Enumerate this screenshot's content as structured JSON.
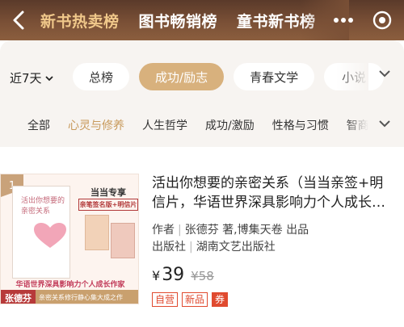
{
  "header": {
    "tabs": [
      {
        "label": "新书热卖榜",
        "active": true
      },
      {
        "label": "图书畅销榜",
        "active": false
      },
      {
        "label": "童书新书榜",
        "active": false
      }
    ],
    "icons": [
      "back-icon",
      "more-icon",
      "target-icon"
    ]
  },
  "filters": {
    "period": "近7天",
    "categories": [
      {
        "label": "总榜"
      },
      {
        "label": "成功/励志",
        "active": true
      },
      {
        "label": "青春文学"
      },
      {
        "label": "小说"
      }
    ],
    "subcategories": [
      {
        "label": "全部"
      },
      {
        "label": "心灵与修养",
        "active": true
      },
      {
        "label": "人生哲学"
      },
      {
        "label": "成功/激励"
      },
      {
        "label": "性格与习惯"
      },
      {
        "label": "智商"
      }
    ]
  },
  "product": {
    "rank": "1",
    "title": "活出你想要的亲密关系（当当亲签+明信片，华语世界深具影响力个人成长作家张德芬",
    "author_label": "作者",
    "author": "张德芬 著,博集天卷 出品",
    "publisher_label": "出版社",
    "publisher": "湖南文艺出版社",
    "currency": "¥",
    "price": "39",
    "original_price": "¥58",
    "tags": [
      "自营",
      "新品",
      "券"
    ],
    "cover": {
      "book_title": "活出你想要的亲密关系",
      "promo_head": "当当专享",
      "promo_sub": "亲笔签名版+明信片",
      "promo_line": "华语世界深具影响力个人成长作家",
      "author_name": "张德芬",
      "tagline": "亲密关系修行静心集大成之作"
    }
  },
  "colors": {
    "header_bg": "#7a5036",
    "active_tab": "#f0c88a",
    "accent_pill": "#d8b17d",
    "price_red": "#e04a2f"
  }
}
